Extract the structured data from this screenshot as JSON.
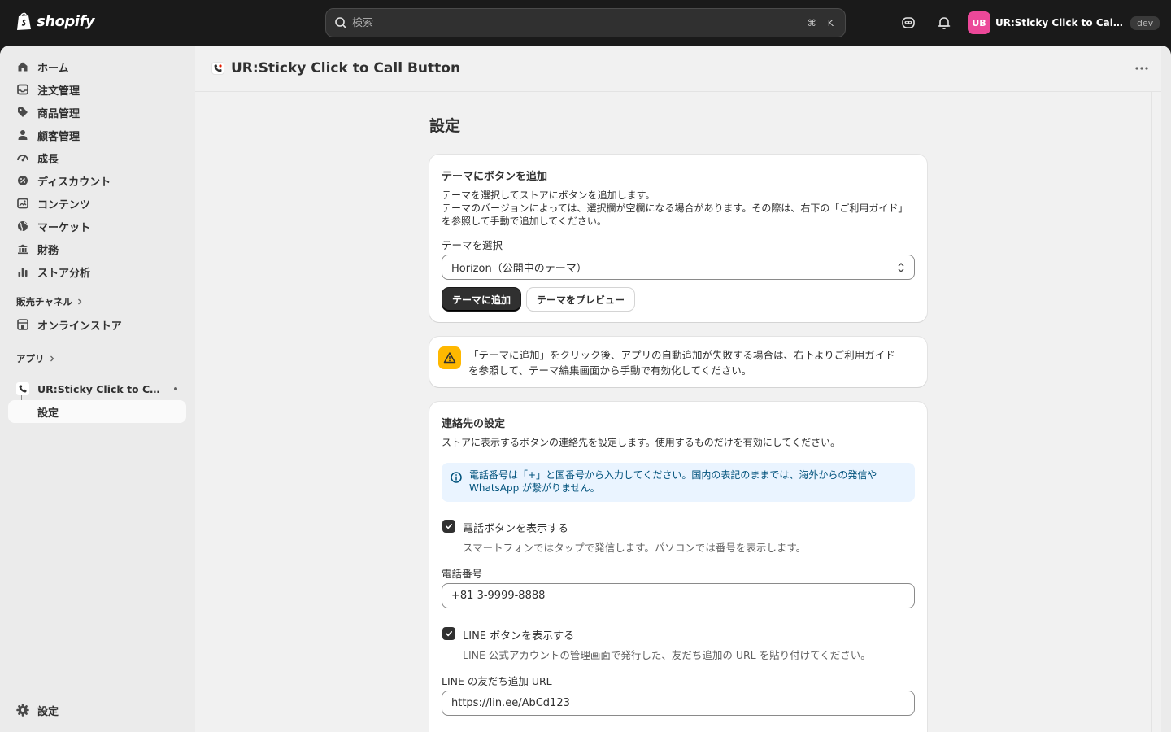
{
  "topbar": {
    "logo_text": "shopify",
    "search_placeholder": "検索",
    "shortcut_cmd": "⌘",
    "shortcut_key": "K",
    "store_initials": "UB",
    "store_name": "UR:Sticky Click to Call Bu...",
    "store_badge": "dev"
  },
  "sidebar": {
    "items": [
      {
        "label": "ホーム",
        "icon": "home-icon"
      },
      {
        "label": "注文管理",
        "icon": "inbox-icon"
      },
      {
        "label": "商品管理",
        "icon": "tag-icon"
      },
      {
        "label": "顧客管理",
        "icon": "person-icon"
      },
      {
        "label": "成長",
        "icon": "gauge-icon"
      },
      {
        "label": "ディスカウント",
        "icon": "discount-icon"
      },
      {
        "label": "コンテンツ",
        "icon": "image-icon"
      },
      {
        "label": "マーケット",
        "icon": "globe-icon"
      },
      {
        "label": "財務",
        "icon": "bank-icon"
      },
      {
        "label": "ストア分析",
        "icon": "bar-chart-icon"
      }
    ],
    "sales_channels_title": "販売チャネル",
    "online_store": "オンラインストア",
    "apps_title": "アプリ",
    "app_name": "UR:Sticky Click to Call ...",
    "app_settings": "設定",
    "settings": "設定"
  },
  "header": {
    "app_title": "UR:Sticky Click to Call Button"
  },
  "page": {
    "title": "設定"
  },
  "theme_card": {
    "heading": "テーマにボタンを追加",
    "desc_line1": "テーマを選択してストアにボタンを追加します。",
    "desc_line2": "テーマのバージョンによっては、選択欄が空欄になる場合があります。その際は、右下の「ご利用ガイド」",
    "desc_line3": "を参照して手動で追加してください。",
    "select_label": "テーマを選択",
    "select_value": "Horizon（公開中のテーマ）",
    "add_button": "テーマに追加",
    "preview_button": "テーマをプレビュー"
  },
  "warning": {
    "line1": "「テーマに追加」をクリック後、アプリの自動追加が失敗する場合は、右下よりご利用ガイド",
    "line2": "を参照して、テーマ編集画面から手動で有効化してください。"
  },
  "contact_card": {
    "heading": "連絡先の設定",
    "desc": "ストアに表示するボタンの連絡先を設定します。使用するものだけを有効にしてください。",
    "info_line1": "電話番号は「+」と国番号から入力してください。国内の表記のままでは、海外からの発信や",
    "info_line2": "WhatsApp が繋がりません。",
    "phone_toggle_label": "電話ボタンを表示する",
    "phone_toggle_help": "スマートフォンではタップで発信します。パソコンでは番号を表示します。",
    "phone_label": "電話番号",
    "phone_value": "+81 3-9999-8888",
    "line_toggle_label": "LINE ボタンを表示する",
    "line_toggle_help": "LINE 公式アカウントの管理画面で発行した、友だち追加の URL を貼り付けてください。",
    "line_url_label": "LINE の友だち追加 URL",
    "line_url_value": "https://lin.ee/AbCd123"
  },
  "colors": {
    "primary": "#303030",
    "avatar": "#ec4899",
    "warning": "#ffb800",
    "info_bg": "#eaf4ff"
  }
}
